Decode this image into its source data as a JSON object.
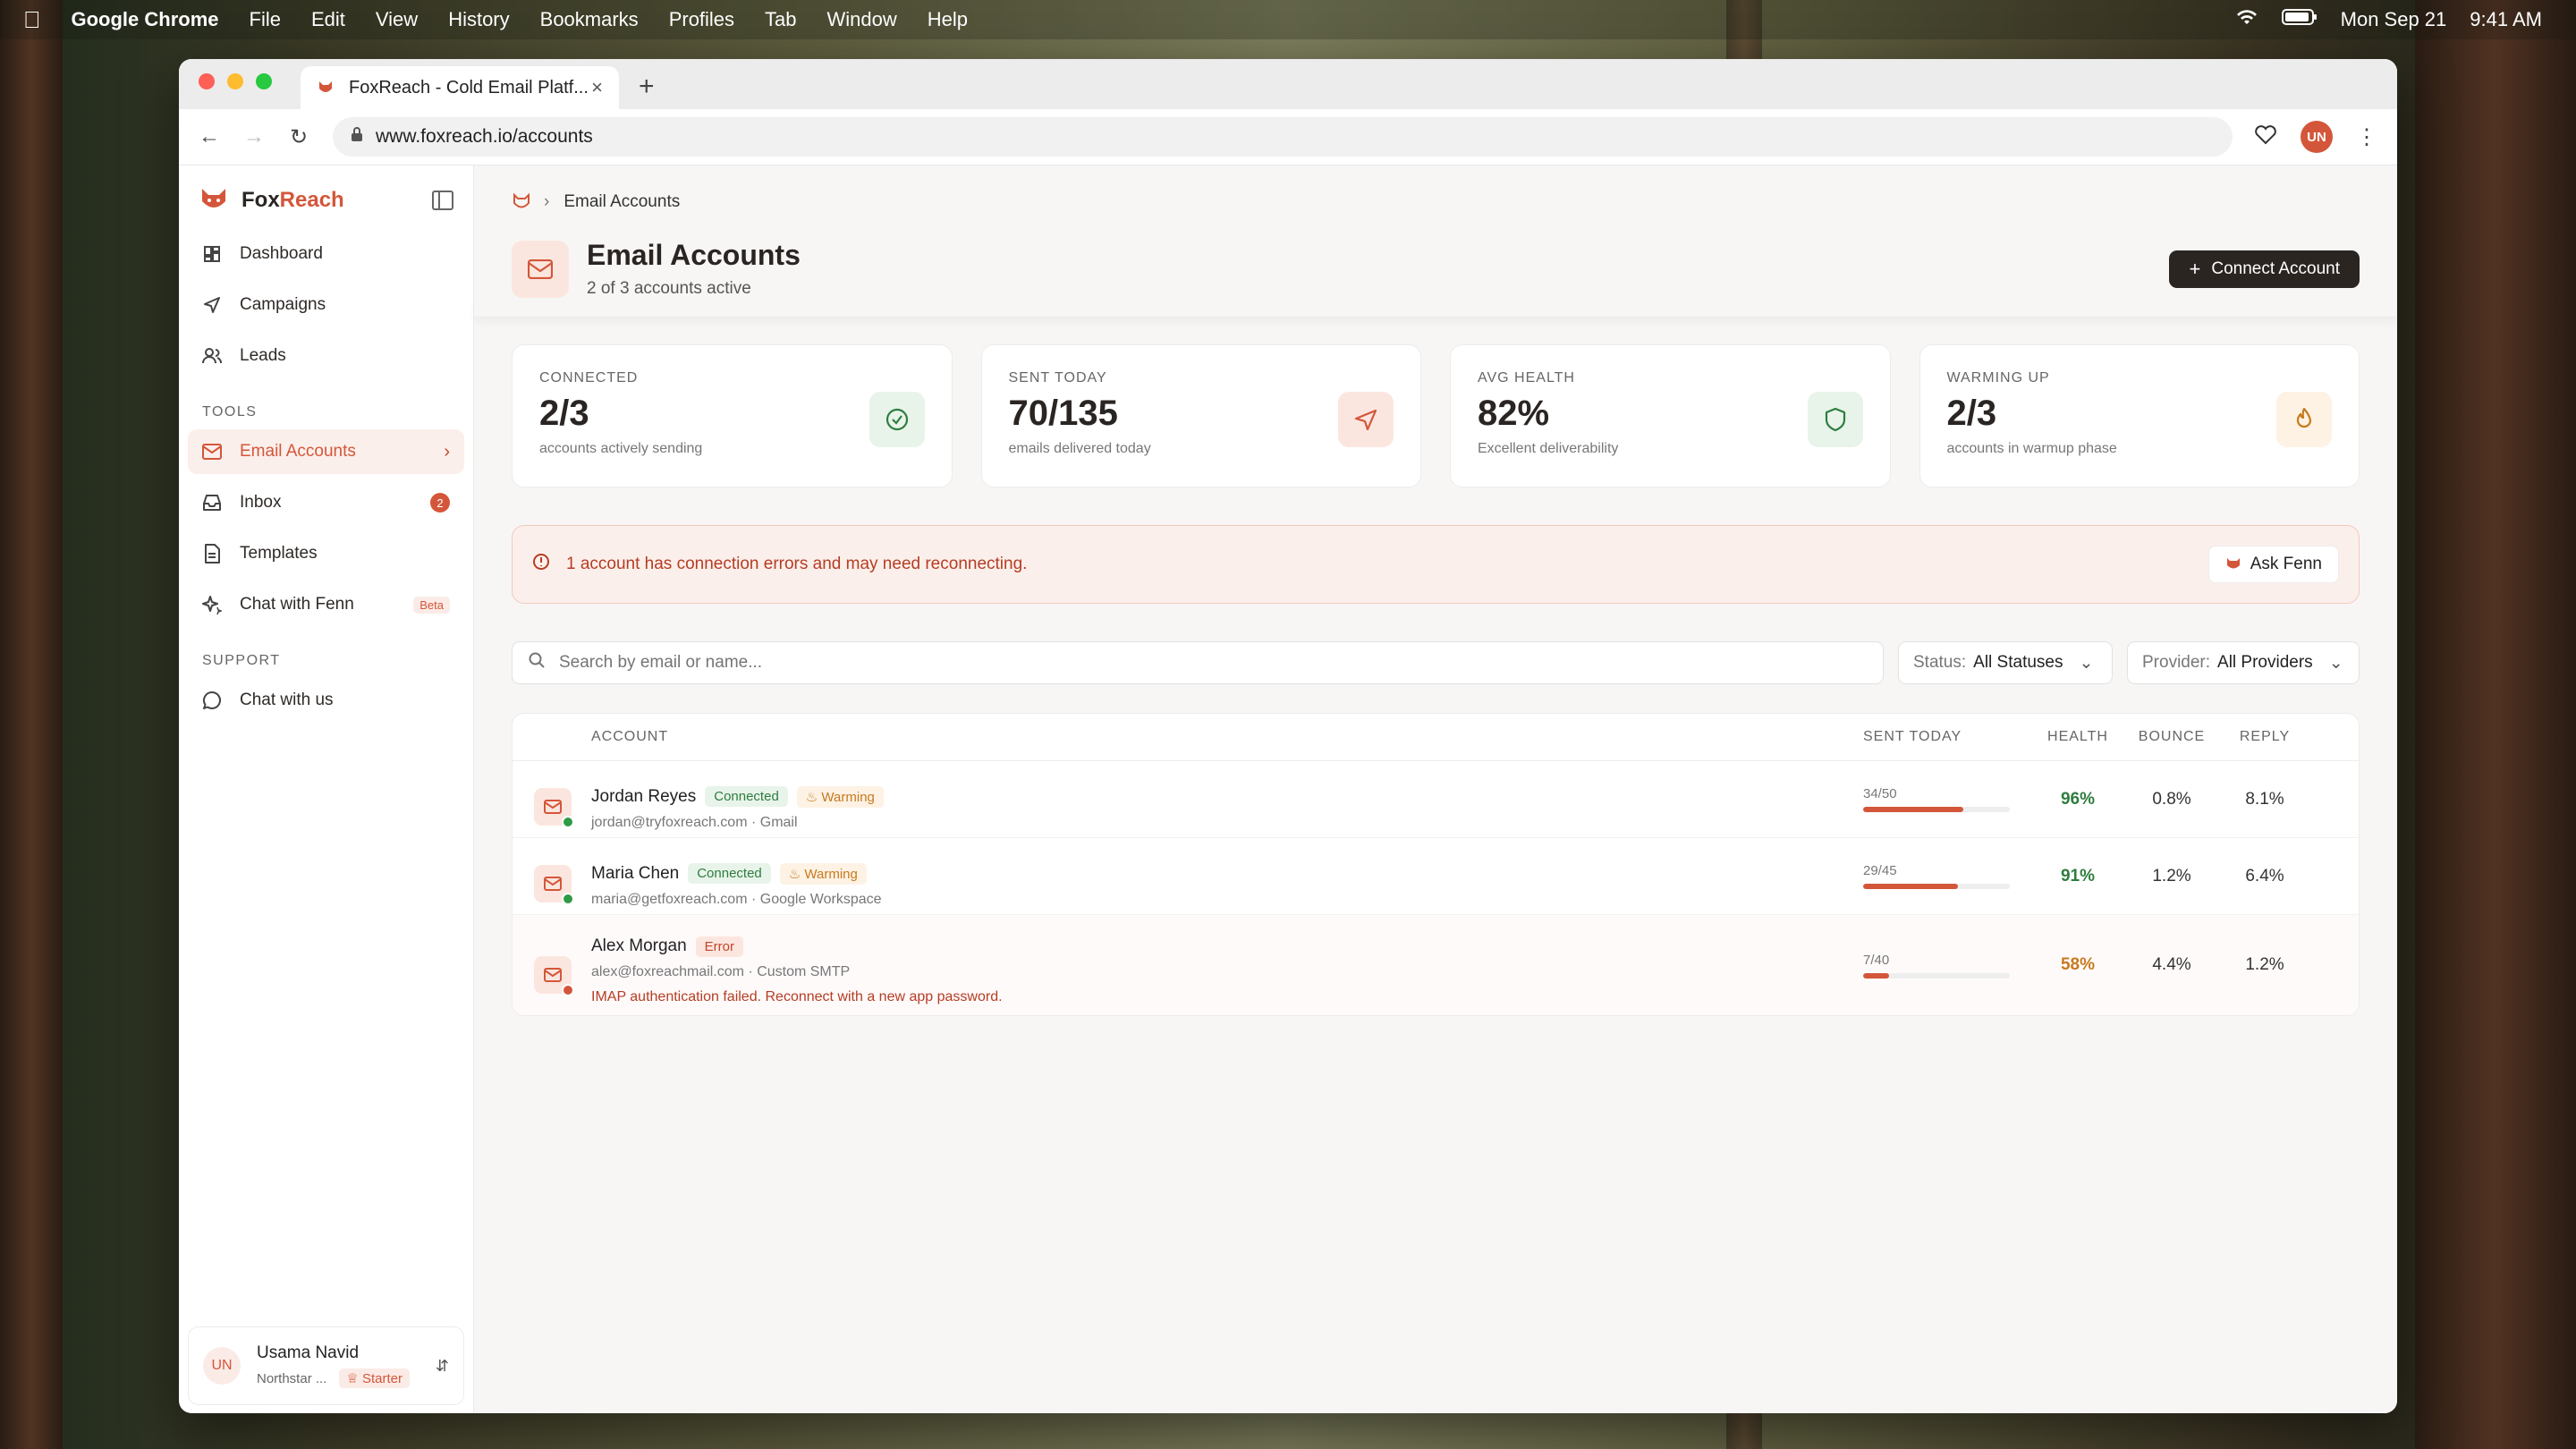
{
  "menubar": {
    "app": "Google Chrome",
    "items": [
      "File",
      "Edit",
      "View",
      "History",
      "Bookmarks",
      "Profiles",
      "Tab",
      "Window",
      "Help"
    ],
    "date": "Mon Sep 21",
    "time": "9:41 AM"
  },
  "browser": {
    "tab_title": "FoxReach - Cold Email Platf...",
    "url": "www.foxreach.io/accounts",
    "profile_initials": "UN"
  },
  "sidebar": {
    "brand_fox": "Fox",
    "brand_reach": "Reach",
    "main_items": [
      {
        "label": "Dashboard",
        "icon": "dashboard-icon"
      },
      {
        "label": "Campaigns",
        "icon": "send-icon"
      },
      {
        "label": "Leads",
        "icon": "users-icon"
      }
    ],
    "tools_label": "TOOLS",
    "tools_items": [
      {
        "label": "Email Accounts",
        "icon": "mail-icon",
        "active": true
      },
      {
        "label": "Inbox",
        "icon": "inbox-icon",
        "count": "2"
      },
      {
        "label": "Templates",
        "icon": "document-icon"
      },
      {
        "label": "Chat with Fenn",
        "icon": "sparkle-icon",
        "badge": "Beta"
      }
    ],
    "support_label": "SUPPORT",
    "support_items": [
      {
        "label": "Chat with us",
        "icon": "chat-icon"
      }
    ],
    "user": {
      "initials": "UN",
      "name": "Usama Navid",
      "org": "Northstar ...",
      "plan": "Starter"
    }
  },
  "page": {
    "breadcrumb": "Email Accounts",
    "title": "Email Accounts",
    "subtitle": "2 of 3 accounts active",
    "connect_label": "Connect Account"
  },
  "stats": [
    {
      "label": "CONNECTED",
      "value": "2/3",
      "desc": "accounts actively sending",
      "icon": "check-circle-icon",
      "color": "#2e7d3f",
      "bg": "#e8f4ea"
    },
    {
      "label": "SENT TODAY",
      "value": "70/135",
      "desc": "emails delivered today",
      "icon": "send-icon",
      "color": "#d4563a",
      "bg": "#fbe6df"
    },
    {
      "label": "AVG HEALTH",
      "value": "82%",
      "desc": "Excellent deliverability",
      "icon": "shield-icon",
      "color": "#2e7d3f",
      "bg": "#e8f4ea"
    },
    {
      "label": "WARMING UP",
      "value": "2/3",
      "desc": "accounts in warmup phase",
      "icon": "flame-icon",
      "color": "#c77a1e",
      "bg": "#fdf2e4"
    }
  ],
  "alert": {
    "message": "1 account has connection errors and may need reconnecting.",
    "button": "Ask Fenn"
  },
  "filters": {
    "search_placeholder": "Search by email or name...",
    "status_label": "Status:",
    "status_value": "All Statuses",
    "provider_label": "Provider:",
    "provider_value": "All Providers"
  },
  "table": {
    "headers": {
      "account": "ACCOUNT",
      "sent": "SENT TODAY",
      "health": "HEALTH",
      "bounce": "BOUNCE",
      "reply": "REPLY"
    },
    "rows": [
      {
        "name": "Jordan Reyes",
        "status": "Connected",
        "warming": "Warming",
        "email": "jordan@tryfoxreach.com · Gmail",
        "sent": "34/50",
        "sent_frac": 0.68,
        "health": "96%",
        "bounce": "0.8%",
        "reply": "8.1%",
        "dot": "#2e9b48"
      },
      {
        "name": "Maria Chen",
        "status": "Connected",
        "warming": "Warming",
        "email": "maria@getfoxreach.com · Google Workspace",
        "sent": "29/45",
        "sent_frac": 0.644,
        "health": "91%",
        "bounce": "1.2%",
        "reply": "6.4%",
        "dot": "#2e9b48"
      },
      {
        "name": "Alex Morgan",
        "status": "Error",
        "email": "alex@foxreachmail.com · Custom SMTP",
        "error": "IMAP authentication failed. Reconnect with a new app password.",
        "sent": "7/40",
        "sent_frac": 0.175,
        "health": "58%",
        "bounce": "4.4%",
        "reply": "1.2%",
        "dot": "#d4563a"
      }
    ]
  }
}
